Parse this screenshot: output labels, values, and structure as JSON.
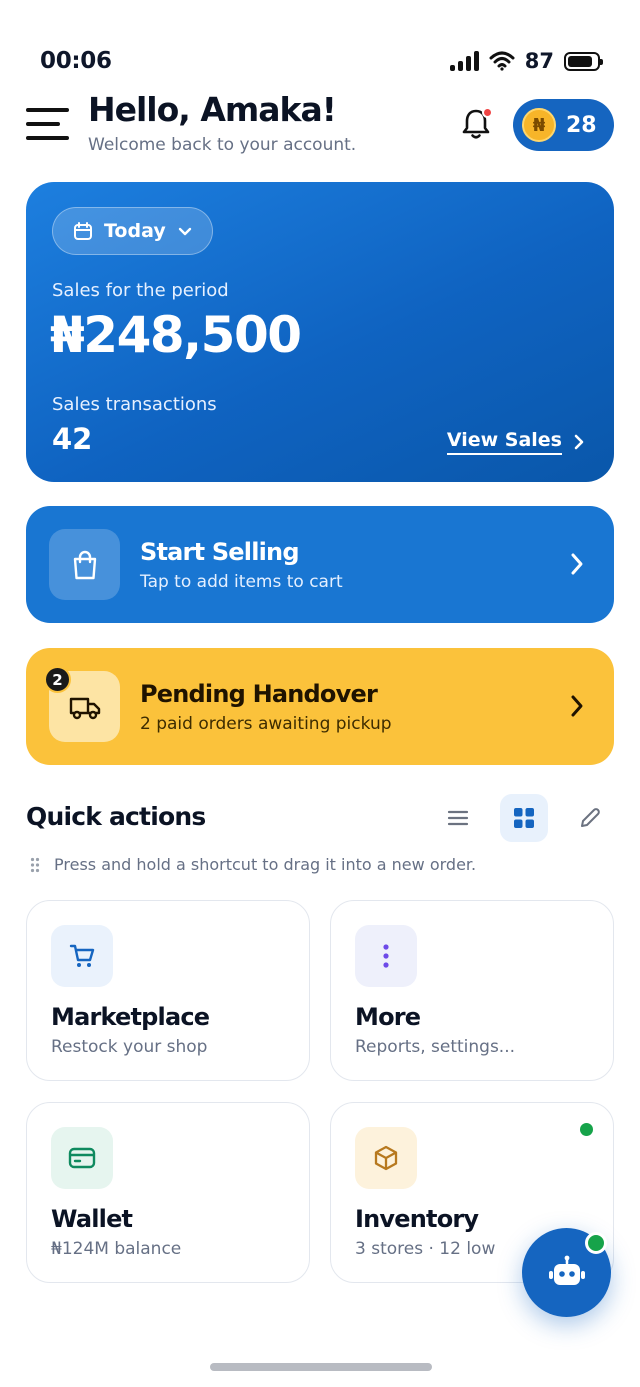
{
  "status_bar": {
    "time": "00:06",
    "battery": "87"
  },
  "header": {
    "greeting": "Hello, Amaka!",
    "subtitle": "Welcome back to your account.",
    "coins": "28",
    "coin_symbol": "₦"
  },
  "sales_card": {
    "period": "Today",
    "period_label": "Sales for the period",
    "amount": "₦248,500",
    "transactions_label": "Sales transactions",
    "transactions": "42",
    "view_link": "View Sales"
  },
  "start_selling": {
    "title": "Start Selling",
    "subtitle": "Tap to add items to cart"
  },
  "pending": {
    "badge": "2",
    "title": "Pending Handover",
    "subtitle": "2 paid orders awaiting pickup"
  },
  "quick_actions": {
    "title": "Quick actions",
    "hint": "Press and hold a shortcut to drag it into a new order.",
    "items": [
      {
        "title": "Marketplace",
        "subtitle": "Restock your shop"
      },
      {
        "title": "More",
        "subtitle": "Reports, settings..."
      },
      {
        "title": "Wallet",
        "subtitle": "₦124M balance"
      },
      {
        "title": "Inventory",
        "subtitle": "3 stores · 12 low"
      }
    ]
  },
  "colors": {
    "primary": "#1565c0",
    "accent_yellow": "#fbc23b",
    "online_green": "#16a34a",
    "alert_red": "#ef4444"
  }
}
